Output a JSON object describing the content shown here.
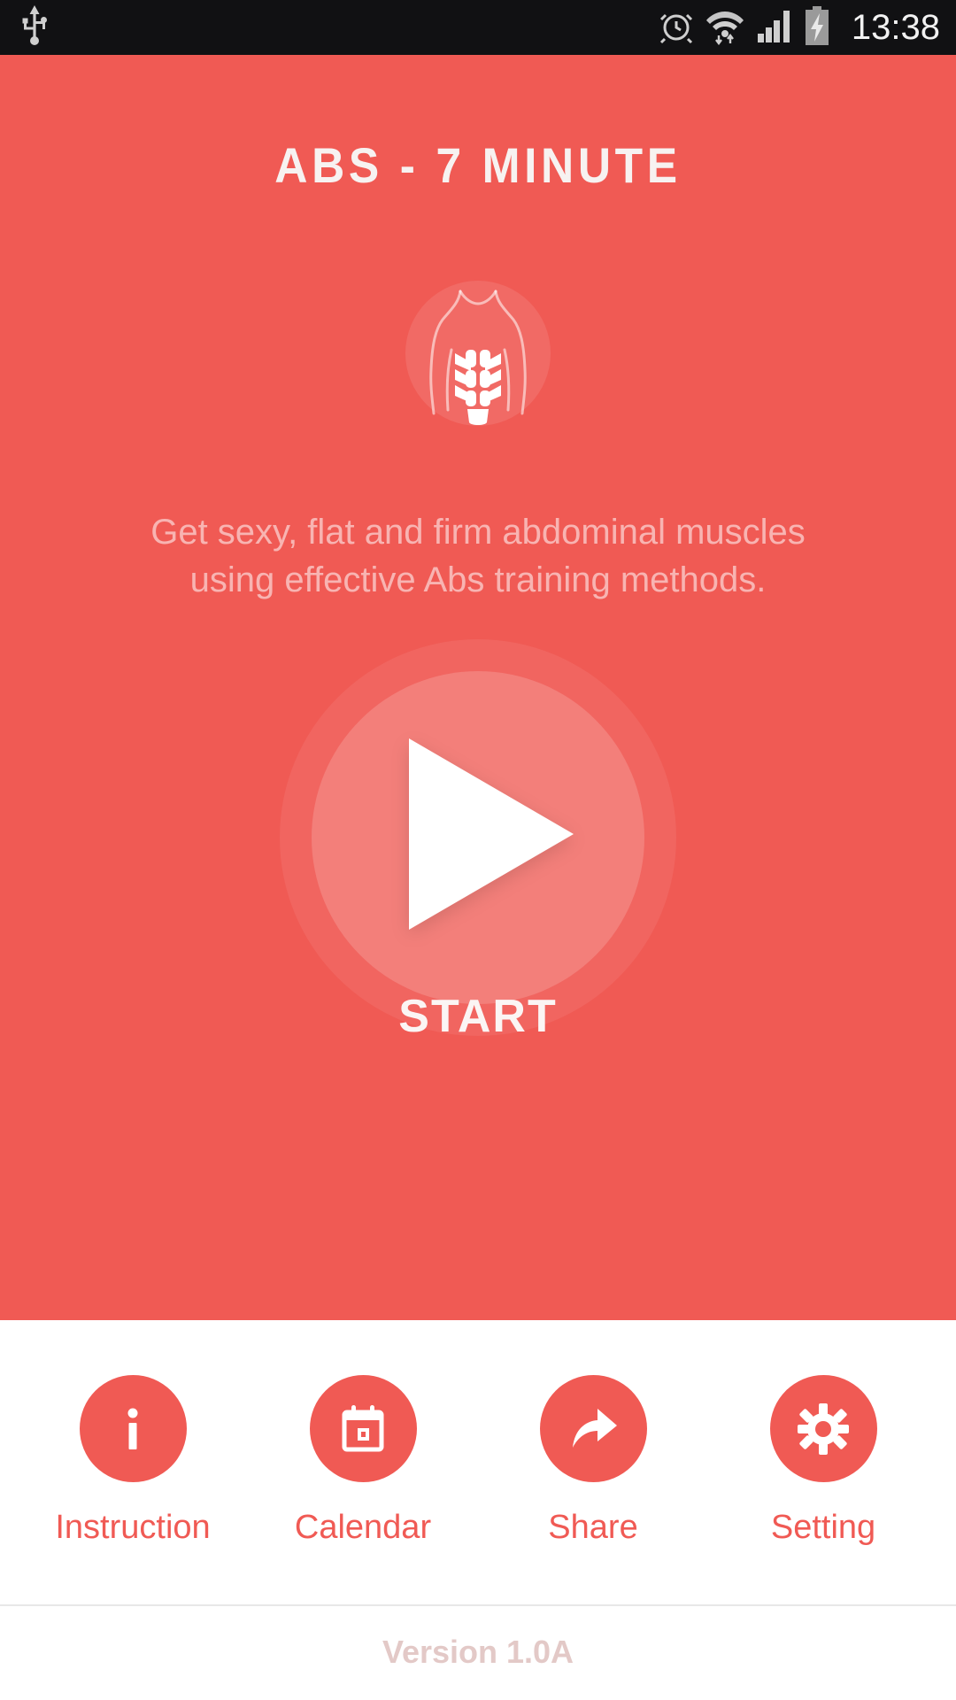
{
  "status_bar": {
    "time": "13:38",
    "icons": {
      "usb": "usb-icon",
      "alarm": "alarm-clock-icon",
      "wifi": "wifi-icon",
      "signal": "cellular-signal-icon",
      "battery": "battery-charging-icon"
    }
  },
  "hero": {
    "title": "ABS - 7 MINUTE",
    "logo_icon": "abs-torso-icon",
    "subtitle_line1": "Get sexy, flat and firm abdominal muscles",
    "subtitle_line2": "using effective Abs training methods.",
    "play_icon": "play-triangle-icon",
    "start_label": "START",
    "background_color": "#f05a54"
  },
  "nav": {
    "items": [
      {
        "label": "Instruction",
        "icon": "info-icon"
      },
      {
        "label": "Calendar",
        "icon": "calendar-icon"
      },
      {
        "label": "Share",
        "icon": "share-arrow-icon"
      },
      {
        "label": "Setting",
        "icon": "gear-icon"
      }
    ],
    "accent_color": "#f05a54"
  },
  "footer": {
    "version": "Version 1.0A"
  }
}
